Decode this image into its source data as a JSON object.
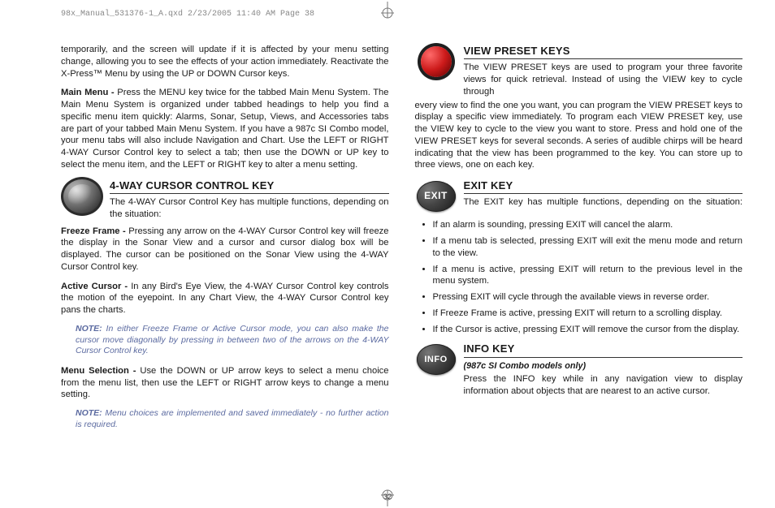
{
  "header": "98x_Manual_531376-1_A.qxd  2/23/2005  11:40 AM  Page 38",
  "page_number": "32",
  "left": {
    "intro": "temporarily, and the screen will update if it is affected by your menu setting change, allowing you to see the effects of your action immediately. Reactivate the X-Press™ Menu by using the UP or DOWN Cursor keys.",
    "mainmenu_label": "Main Menu - ",
    "mainmenu_text": "Press the MENU key twice for the tabbed Main Menu System. The Main Menu System is organized under tabbed headings to help you find a specific menu item quickly: Alarms, Sonar, Setup, Views, and Accessories tabs are part of your tabbed Main Menu System. If you have a 987c SI Combo model, your menu tabs will also include Navigation and Chart. Use the LEFT or RIGHT 4-WAY Cursor Control key to select a tab; then use the DOWN or UP key to select the menu item, and the LEFT or RIGHT key to alter a menu setting.",
    "cursor_heading": "4-WAY CURSOR CONTROL KEY",
    "cursor_intro": "The 4-WAY Cursor Control Key has multiple functions, depending on the situation:",
    "freeze_label": "Freeze Frame - ",
    "freeze_text": "Pressing any arrow on the 4-WAY Cursor Control key will freeze the display in the Sonar View and a cursor and cursor dialog box will be displayed. The cursor can be positioned on the Sonar View using the 4-WAY Cursor Control key.",
    "active_label": "Active Cursor - ",
    "active_text": "In any Bird's Eye View, the 4-WAY Cursor Control key controls the motion of the eyepoint. In any Chart View, the 4-WAY Cursor Control key pans the charts.",
    "note1_label": "NOTE: ",
    "note1_text": "In either Freeze Frame or Active Cursor mode, you can also make the cursor move diagonally by pressing in between two of the arrows on the 4-WAY Cursor Control key.",
    "menusel_label": "Menu Selection - ",
    "menusel_text": "Use the DOWN or UP arrow keys to select a menu choice from the menu list, then use the LEFT or RIGHT arrow keys to change a menu setting.",
    "note2_label": "NOTE: ",
    "note2_text": "Menu choices are implemented and saved immediately - no further action is required."
  },
  "right": {
    "preset_heading": "VIEW PRESET KEYS",
    "preset_intro": "The VIEW PRESET keys are used to program your three favorite views for quick retrieval. Instead of using the VIEW key to cycle through",
    "preset_cont": "every view to find the one you want, you can program the VIEW PRESET keys to display a specific view immediately. To program each VIEW PRESET key, use the VIEW key to cycle to the view you want to store. Press and hold one of the VIEW PRESET keys for several seconds. A series of audible chirps will be heard indicating that the view has been programmed to the key. You can store up to three views, one on each key.",
    "exit_heading": "EXIT KEY",
    "exit_label": "EXIT",
    "exit_intro": "The EXIT key has multiple functions, depending on the situation:",
    "exit_bullets": [
      "If an alarm is sounding, pressing EXIT will cancel the alarm.",
      "If a menu tab is selected, pressing EXIT will exit the menu mode and return to the view.",
      "If a menu is active, pressing EXIT will return to the previous level in the menu system.",
      "Pressing EXIT will cycle through the available views in reverse order.",
      "If Freeze Frame is active, pressing EXIT will return to a scrolling display.",
      "If the Cursor is active, pressing EXIT will remove the cursor from the display."
    ],
    "info_heading": "INFO KEY",
    "info_label": "INFO",
    "info_sub": "(987c SI Combo models only)",
    "info_text": "Press the INFO key while in any navigation view to display information about objects that are nearest to an active cursor."
  }
}
